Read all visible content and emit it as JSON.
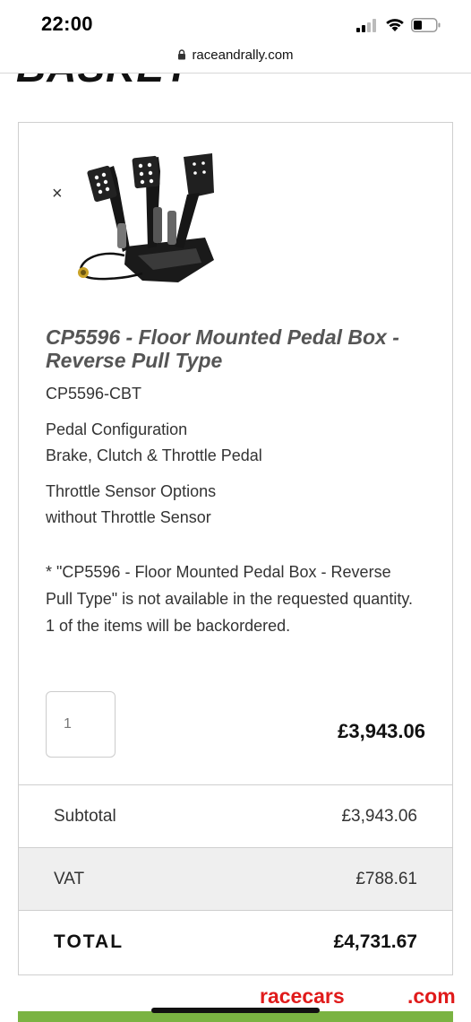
{
  "status_bar": {
    "time": "22:00",
    "signal_icon": "cellular-signal-icon",
    "wifi_icon": "wifi-icon",
    "battery_icon": "battery-icon"
  },
  "browser": {
    "url": "raceandrally.com",
    "lock_icon": "lock-icon"
  },
  "page": {
    "heading": "BASKET"
  },
  "basket_item": {
    "remove_label": "×",
    "image_icon": "pedal-box-product-image",
    "title": "CP5596 - Floor Mounted Pedal Box - Reverse Pull Type",
    "sku": "CP5596-CBT",
    "options": [
      {
        "name": "Pedal Configuration",
        "value": "Brake, Clutch & Throttle Pedal"
      },
      {
        "name": "Throttle Sensor Options",
        "value": "without Throttle Sensor"
      }
    ],
    "backorder_notice": "* \"CP5596 - Floor Mounted Pedal Box - Reverse Pull Type\" is not available in the requested quantity. 1 of the items will be backordered.",
    "quantity": "1",
    "line_total": "£3,943.06"
  },
  "totals": {
    "subtotal_label": "Subtotal",
    "subtotal_value": "£3,943.06",
    "vat_label": "VAT",
    "vat_value": "£788.61",
    "total_label": "TOTAL",
    "total_value": "£4,731.67"
  },
  "watermark": {
    "left": "racecars",
    "right": ".com"
  },
  "colors": {
    "accent_green": "#7ab342",
    "watermark_red": "#e01b1b",
    "vat_row_bg": "#efefef"
  }
}
